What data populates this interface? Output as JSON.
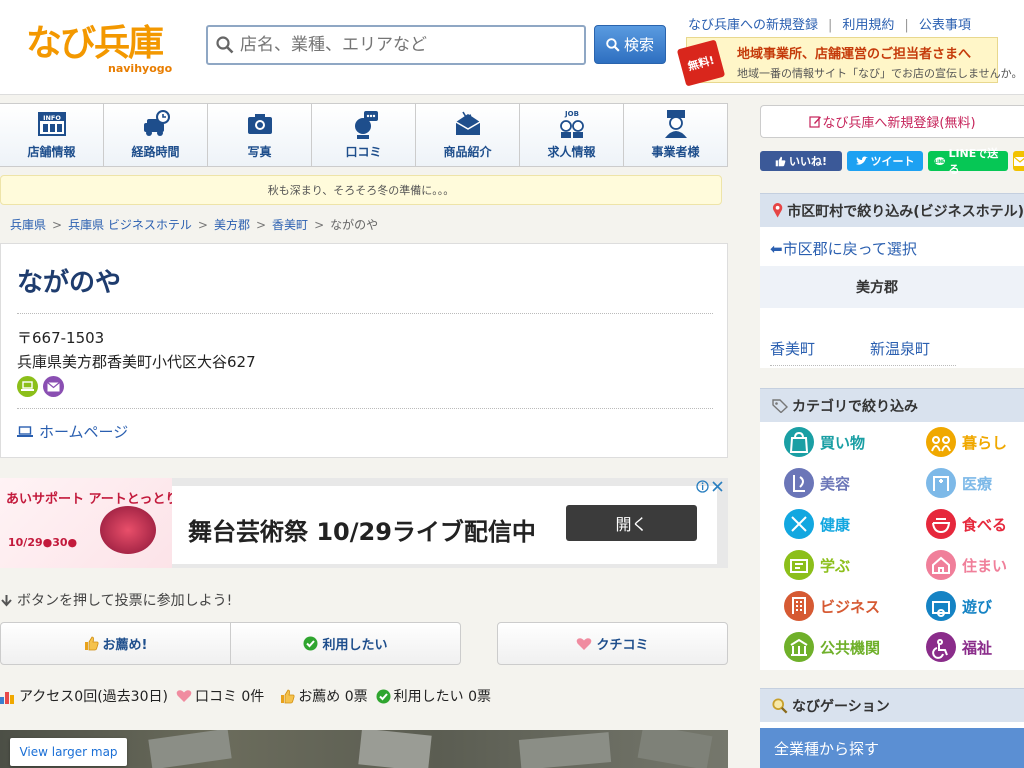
{
  "header": {
    "logo_text": "なび兵庫",
    "logo_sub": "navihyogo",
    "search_placeholder": "店名、業種、エリアなど",
    "search_button": "検索",
    "links": [
      "なび兵庫への新規登録",
      "利用規約",
      "公表事項"
    ],
    "owner_banner": {
      "badge": "無料!",
      "line1": "地域事業所、店舗運営のご担当者さまへ",
      "line2": "地域一番の情報サイト「なび」でお店の宣伝しませんか。"
    }
  },
  "nav_tabs": [
    {
      "label": "店舗情報",
      "icon": "info-icon"
    },
    {
      "label": "経路時間",
      "icon": "car-clock-icon"
    },
    {
      "label": "写真",
      "icon": "camera-icon"
    },
    {
      "label": "口コミ",
      "icon": "speech-bubble-icon"
    },
    {
      "label": "商品紹介",
      "icon": "product-icon"
    },
    {
      "label": "求人情報",
      "icon": "job-icon"
    },
    {
      "label": "事業者様",
      "icon": "business-person-icon"
    }
  ],
  "notice": "秋も深まり、そろそろ冬の準備に。。。",
  "breadcrumb": [
    "兵庫県",
    "兵庫県 ビジネスホテル",
    "美方郡",
    "香美町",
    "ながのや"
  ],
  "shop": {
    "name": "ながのや",
    "zip": "〒667-1503",
    "address": "兵庫県美方郡香美町小代区大谷627",
    "homepage_label": "ホームページ"
  },
  "ad": {
    "left_title": "あいサポート アートとっとり祭",
    "left_dates": "10/29●30●",
    "headline": "舞台芸術祭 10/29ライブ配信中",
    "open_button": "開く"
  },
  "vote": {
    "prompt": "ボタンを押して投票に参加しよう!",
    "recommend": "お薦め!",
    "want_use": "利用したい",
    "kuchikomi": "クチコミ"
  },
  "stats": {
    "access": "アクセス0回(過去30日)",
    "reviews": "口コミ 0件",
    "recommend": "お薦め 0票",
    "want_use": "利用したい 0票"
  },
  "map": {
    "larger_label": "View larger map"
  },
  "sidebar": {
    "register": "なび兵庫へ新規登録(無料)",
    "social": {
      "facebook": "いいね!",
      "twitter": "ツイート",
      "line": "LINEで送る"
    },
    "area_title": "市区町村で絞り込み(ビジネスホテル)",
    "back_link": "⬅市区郡に戻って選択",
    "county": "美方郡",
    "towns": [
      "香美町",
      "新温泉町"
    ],
    "category_title": "カテゴリで絞り込み",
    "categories": [
      {
        "label": "買い物",
        "color": "#1a9fa4",
        "icon": "shopping-bag-icon"
      },
      {
        "label": "暮らし",
        "color": "#f0a800",
        "icon": "family-icon"
      },
      {
        "label": "美容",
        "color": "#6b76b8",
        "icon": "beauty-icon"
      },
      {
        "label": "医療",
        "color": "#7db9e8",
        "icon": "hospital-icon"
      },
      {
        "label": "健康",
        "color": "#12a7e0",
        "icon": "health-icon"
      },
      {
        "label": "食べる",
        "color": "#e6283c",
        "icon": "bowl-icon"
      },
      {
        "label": "学ぶ",
        "color": "#8cbf1a",
        "icon": "study-icon"
      },
      {
        "label": "住まい",
        "color": "#f07f9a",
        "icon": "house-icon"
      },
      {
        "label": "ビジネス",
        "color": "#d65a33",
        "icon": "building-icon"
      },
      {
        "label": "遊び",
        "color": "#1583c4",
        "icon": "camera-icon"
      },
      {
        "label": "公共機関",
        "color": "#6fb02a",
        "icon": "public-icon"
      },
      {
        "label": "福祉",
        "color": "#8a2c8a",
        "icon": "wheelchair-icon"
      }
    ],
    "navigation_title": "なびゲーション",
    "all_industries": "全業種から探す"
  }
}
